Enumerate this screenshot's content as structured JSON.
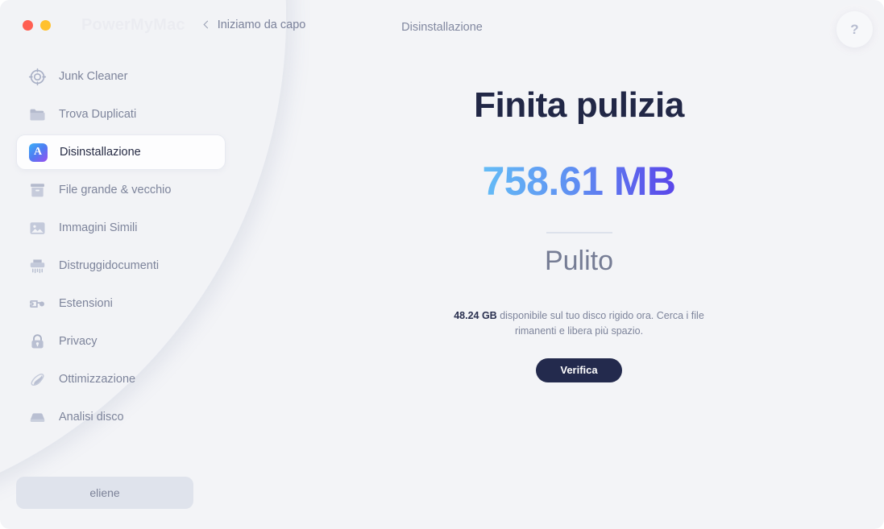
{
  "window": {
    "brand": "PowerMyMac",
    "back_label": "Iniziamo da capo",
    "page_heading": "Disinstallazione",
    "help_label": "?",
    "traffic_lights": [
      "close",
      "minimize"
    ],
    "colors": {
      "background": "#f3f4f7",
      "accent_start": "#64bdf6",
      "accent_end": "#5a45e9",
      "cta_bg": "#232a4d",
      "text_primary": "#212746",
      "text_muted": "#7d849b"
    }
  },
  "sidebar": {
    "items": [
      {
        "label": "Junk Cleaner",
        "icon": "target-icon",
        "active": false
      },
      {
        "label": "Trova Duplicati",
        "icon": "folder-icon",
        "active": false
      },
      {
        "label": "Disinstallazione",
        "icon": "app-store-icon",
        "active": true
      },
      {
        "label": "File grande & vecchio",
        "icon": "archive-box-icon",
        "active": false
      },
      {
        "label": "Immagini Simili",
        "icon": "image-icon",
        "active": false
      },
      {
        "label": "Distruggidocumenti",
        "icon": "shredder-icon",
        "active": false
      },
      {
        "label": "Estensioni",
        "icon": "plug-icon",
        "active": false
      },
      {
        "label": "Privacy",
        "icon": "lock-icon",
        "active": false
      },
      {
        "label": "Ottimizzazione",
        "icon": "rocket-icon",
        "active": false
      },
      {
        "label": "Analisi disco",
        "icon": "hard-drive-icon",
        "active": false
      }
    ],
    "bottom_button": "eliene"
  },
  "main": {
    "title": "Finita pulizia",
    "size_cleaned": "758.61 MB",
    "state": "Pulito",
    "free_space": "48.24 GB",
    "description": "disponibile sul tuo disco rigido ora. Cerca i file rimanenti e libera più spazio.",
    "cta_label": "Verifica"
  }
}
